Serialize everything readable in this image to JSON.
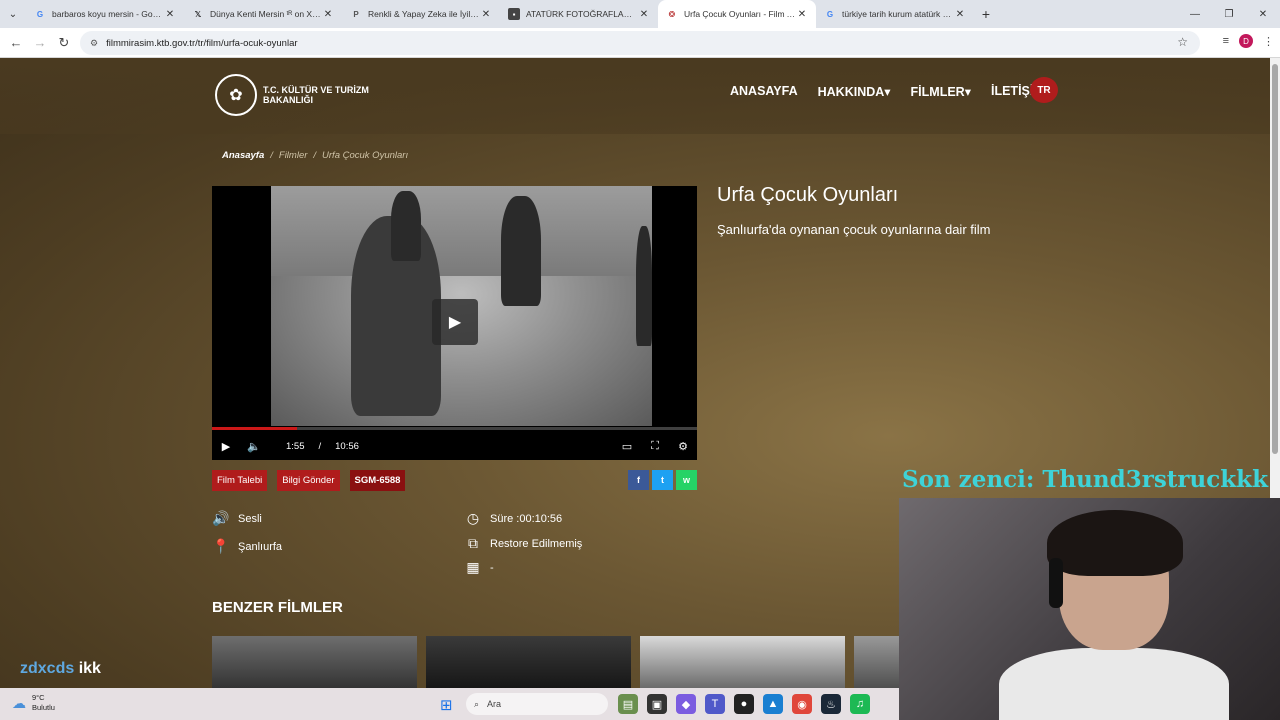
{
  "browser": {
    "tabs": [
      {
        "title": "barbaros koyu mersin - Google",
        "favicon": "google-icon",
        "active": false
      },
      {
        "title": "Dünya Kenti Mersin ᵗᴿ on X: \"M",
        "favicon": "x-icon",
        "active": false
      },
      {
        "title": "Renkli & Yapay Zeka ile İyileştir",
        "favicon": "p-icon",
        "active": false
      },
      {
        "title": "ATATÜRK FOTOĞRAFLARI - Atat",
        "favicon": "site-icon",
        "active": false
      },
      {
        "title": "Urfa Çocuk Oyunları - Film Arşi",
        "favicon": "ktb-icon",
        "active": true
      },
      {
        "title": "türkiye tarih kurum atatürk arşi",
        "favicon": "google-icon",
        "active": false
      }
    ],
    "url": "filmmirasim.ktb.gov.tr/tr/film/urfa-ocuk-oyunlar",
    "avatar_letter": "D"
  },
  "site": {
    "logo_text": "T.C. KÜLTÜR VE TURİZM BAKANLIĞI",
    "menu": [
      {
        "label": "ANASAYFA"
      },
      {
        "label": "HAKKINDA▾"
      },
      {
        "label": "FİLMLER▾"
      },
      {
        "label": "İLETİŞİM"
      }
    ],
    "lang": "TR",
    "breadcrumb": {
      "home": "Anasayfa",
      "section": "Filmler",
      "current": "Urfa Çocuk Oyunları"
    }
  },
  "video": {
    "current_time": "1:55",
    "duration": "10:56",
    "progress_fraction": 0.175
  },
  "film": {
    "title": "Urfa Çocuk Oyunları",
    "description": "Şanlıurfa'da oynanan çocuk oyunlarına dair film",
    "buttons": {
      "request": "Film Talebi",
      "info": "Bilgi Gönder",
      "code": "SGM-6588"
    },
    "share": [
      "f",
      "t",
      "w"
    ],
    "meta": {
      "sound": "Sesli",
      "location": "Şanlıurfa",
      "duration": "Süre :00:10:56",
      "restore": "Restore Edilmemiş",
      "date": "-"
    }
  },
  "similar_heading": "BENZER FİLMLER",
  "overlay": {
    "caption": "Son zenci: Thund3rstruckkk",
    "handle_a": "zdxcds",
    "handle_b": "ikk"
  },
  "taskbar": {
    "temp": "9°C",
    "condition": "Bulutlu",
    "search_placeholder": "Ara"
  },
  "colors": {
    "accent_red": "#b01c1c",
    "site_brown": "#5e4a2a",
    "overlay_cyan": "#3ed3d8"
  }
}
